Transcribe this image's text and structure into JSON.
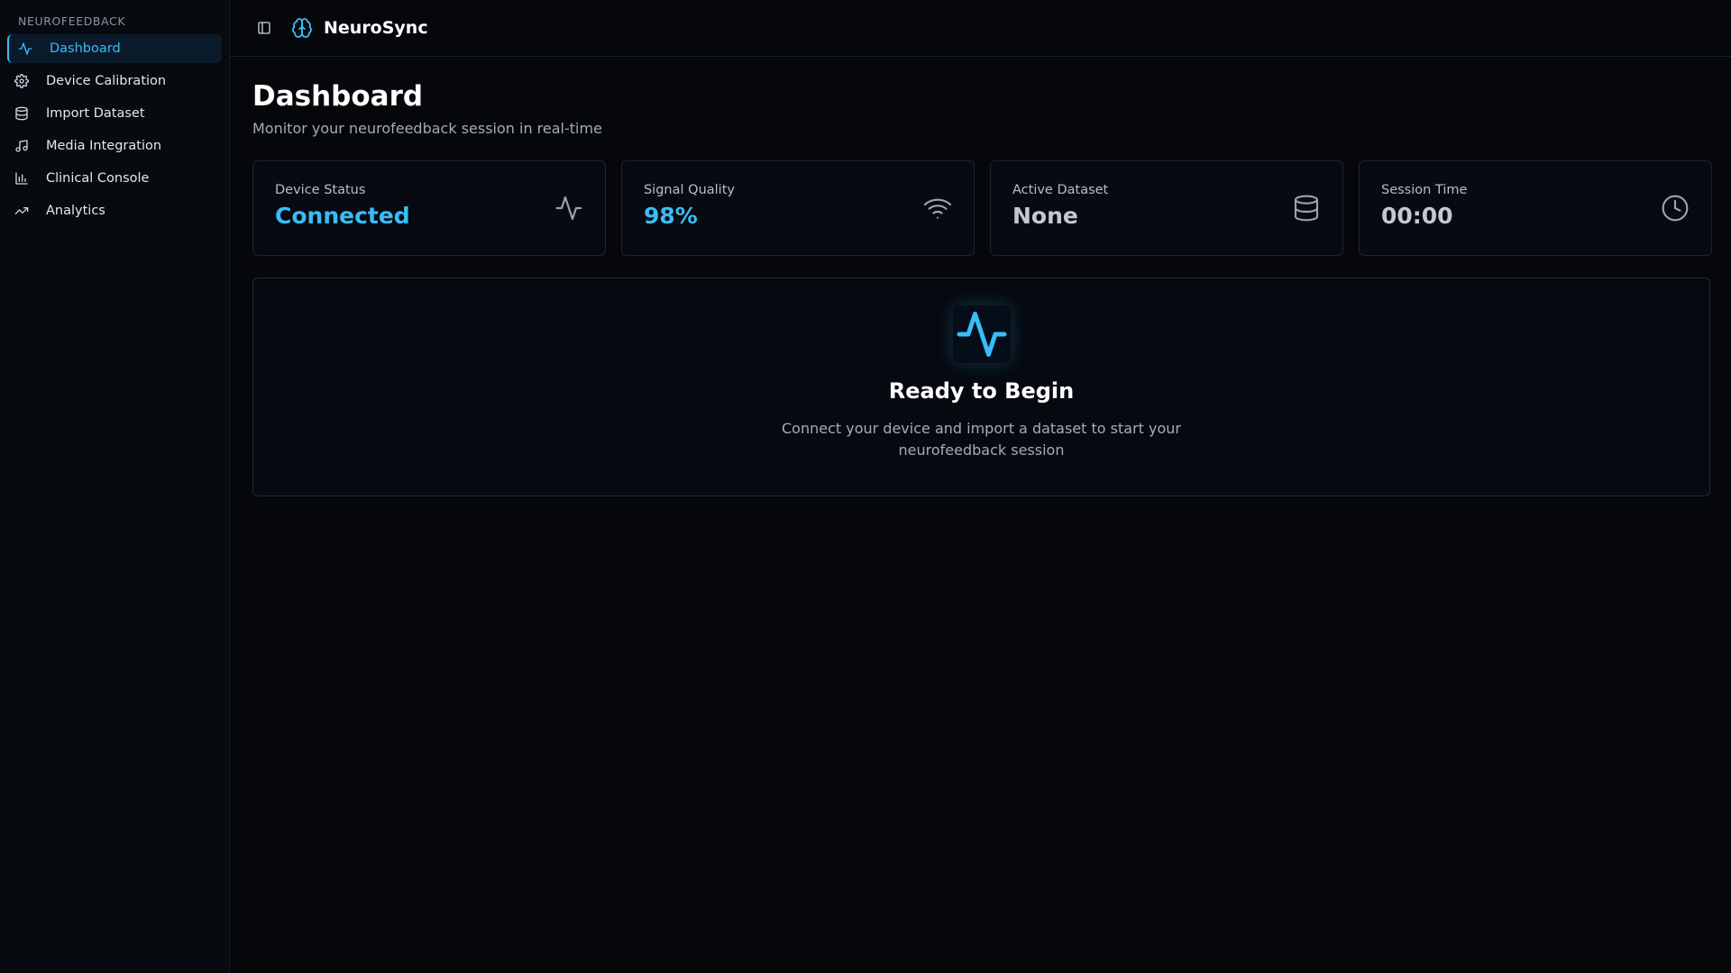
{
  "sidebar": {
    "section_label": "NEUROFEEDBACK",
    "items": [
      {
        "label": "Dashboard",
        "icon": "activity-icon"
      },
      {
        "label": "Device Calibration",
        "icon": "gear-icon"
      },
      {
        "label": "Import Dataset",
        "icon": "database-icon"
      },
      {
        "label": "Media Integration",
        "icon": "music-icon"
      },
      {
        "label": "Clinical Console",
        "icon": "bar-chart-icon"
      },
      {
        "label": "Analytics",
        "icon": "trending-up-icon"
      }
    ],
    "active_index": 0
  },
  "header": {
    "brand": "NeuroSync",
    "brand_icon": "brain-icon",
    "toggle_icon": "sidebar-toggle-icon"
  },
  "main": {
    "title": "Dashboard",
    "subtitle": "Monitor your neurofeedback session in real-time",
    "stats": [
      {
        "label": "Device Status",
        "value": "Connected",
        "icon": "activity-icon"
      },
      {
        "label": "Signal Quality",
        "value": "98%",
        "icon": "wifi-icon"
      },
      {
        "label": "Active Dataset",
        "value": "None",
        "icon": "database-icon"
      },
      {
        "label": "Session Time",
        "value": "00:00",
        "icon": "clock-icon"
      }
    ],
    "hero": {
      "icon": "activity-icon",
      "title": "Ready to Begin",
      "text": "Connect your device and import a dataset to start your neurofeedback session"
    }
  },
  "colors": {
    "accent": "#38bdf8",
    "background": "#05070b",
    "sidebar": "#070a0f",
    "card_border": "#1c2530"
  }
}
